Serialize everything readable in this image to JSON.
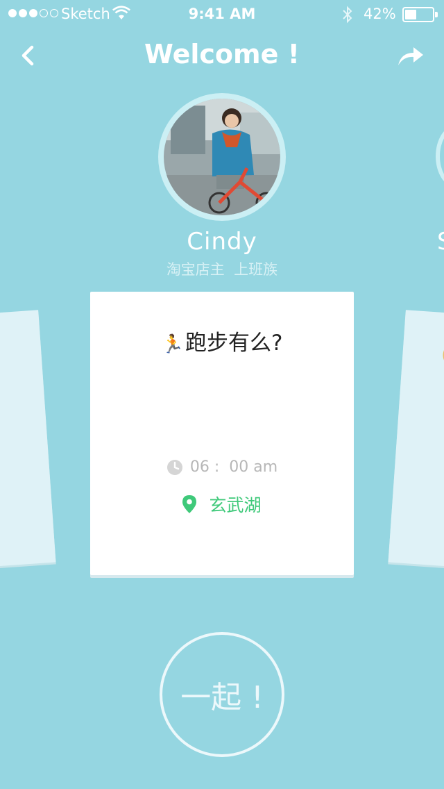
{
  "status_bar": {
    "carrier": "Sketch",
    "time": "9:41 AM",
    "battery_text": "42%",
    "battery_level": 0.42,
    "signal_strength": 3,
    "signal_total": 5
  },
  "nav": {
    "title": "Welcome !",
    "back_icon": "chevron-left-icon",
    "share_icon": "share-arrow-icon"
  },
  "profile": {
    "name": "Cindy",
    "tags": "淘宝店主  上班族",
    "next_name_fragment": "S"
  },
  "card": {
    "runner_emoji": "🏃",
    "title": "跑步有么?",
    "time": "06 :  00 am",
    "location": "玄武湖"
  },
  "join_button": {
    "label": "一起 !"
  },
  "colors": {
    "background": "#95d6e1",
    "card": "#ffffff",
    "side_card": "#dff2f7",
    "location_green": "#3fc97a",
    "time_gray": "#b7b7b7"
  }
}
